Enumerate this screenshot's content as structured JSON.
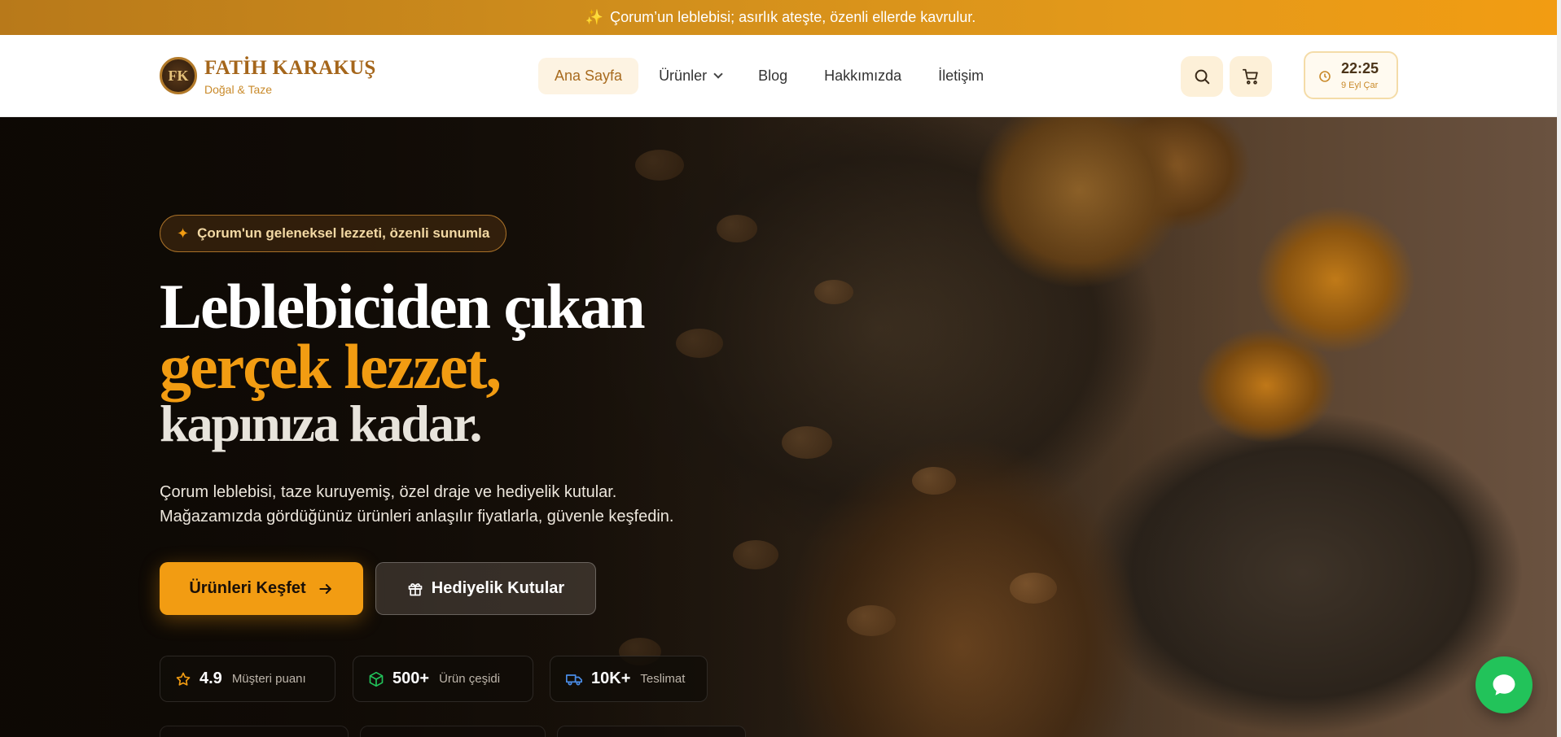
{
  "promo": {
    "text": "Çorum’un leblebisi; asırlık ateşte, özenli ellerde kavrulur.",
    "icon": "sparkle-icon"
  },
  "brand": {
    "monogram": "FK",
    "name": "FATİH KARAKUŞ",
    "tagline": "Doğal & Taze",
    "color": "#a5661b"
  },
  "nav": {
    "items": [
      {
        "label": "Ana Sayfa",
        "active": true
      },
      {
        "label": "Ürünler",
        "has_dropdown": true
      },
      {
        "label": "Blog"
      },
      {
        "label": "Hakkımızda"
      },
      {
        "label": "İletişim"
      }
    ]
  },
  "header_actions": {
    "search_icon": "search-icon",
    "cart_icon": "cart-icon"
  },
  "clock": {
    "time": "22:25",
    "date": "9 Eyl Çar"
  },
  "hero": {
    "badge": "Çorum'un geleneksel lezzeti, özenli sunumla",
    "headline_line1": "Leblebiciden çıkan",
    "headline_line2": "gerçek lezzet,",
    "headline_line3": "kapınıza kadar.",
    "description_line1": "Çorum leblebisi, taze kuruyemiş, özel draje ve hediyelik kutular.",
    "description_line2": "Mağazamızda gördüğünüz ürünleri anlaşılır fiyatlarla, güvenle keşfedin.",
    "primary_button": "Ürünleri Keşfet",
    "secondary_button": "Hediyelik Kutular",
    "accent": "#f29c12"
  },
  "stats": [
    {
      "value": "4.9",
      "label": "Müşteri puanı",
      "icon": "star-icon"
    },
    {
      "value": "500+",
      "label": "Ürün çeşidi",
      "icon": "box-icon"
    },
    {
      "value": "10K+",
      "label": "Teslimat",
      "icon": "truck-icon"
    }
  ],
  "chat": {
    "icon": "chat-bubble-icon",
    "color": "#22c35a"
  }
}
